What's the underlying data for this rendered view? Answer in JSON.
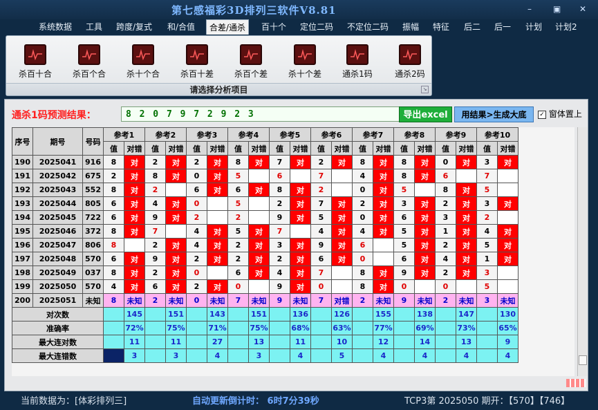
{
  "window": {
    "title": "第七感福彩3D排列三软件V8.81",
    "minimize": "–",
    "restore": "▣",
    "close": "✕"
  },
  "menu": [
    "系统数据",
    "工具",
    "跨度/复式",
    "和/合值",
    "合差/通杀",
    "百十个",
    "定位二码",
    "不定位二码",
    "振幅",
    "特征",
    "后二",
    "后一",
    "计划",
    "计划2"
  ],
  "ribbon": {
    "buttons": [
      "杀百十合",
      "杀百个合",
      "杀十个合",
      "杀百十差",
      "杀百个差",
      "杀十个差",
      "通杀1码",
      "通杀2码"
    ],
    "caption": "请选择分析项目"
  },
  "prediction": {
    "label": "通杀1码预测结果：",
    "value": "8 2 0 7 9 7 2 9 2 3"
  },
  "buttons": {
    "excel": "导出excel",
    "generate": "用结果>生成大底"
  },
  "checkbox": {
    "label": "窗体置上",
    "checked": "✓"
  },
  "grid": {
    "headers": {
      "seq": "序号",
      "period": "期号",
      "number": "号码",
      "val": "值",
      "judge": "对错"
    },
    "refs": [
      "参考1",
      "参考2",
      "参考3",
      "参考4",
      "参考5",
      "参考6",
      "参考7",
      "参考8",
      "参考9",
      "参考10"
    ],
    "rows": [
      {
        "seq": "190",
        "period": "2025041",
        "number": "916",
        "cells": [
          [
            "8",
            "对",
            1
          ],
          [
            "2",
            "对",
            1
          ],
          [
            "2",
            "对",
            1
          ],
          [
            "8",
            "对",
            1
          ],
          [
            "7",
            "对",
            1
          ],
          [
            "2",
            "对",
            1
          ],
          [
            "8",
            "对",
            1
          ],
          [
            "8",
            "对",
            1
          ],
          [
            "0",
            "对",
            1
          ],
          [
            "3",
            "对",
            1
          ]
        ]
      },
      {
        "seq": "191",
        "period": "2025042",
        "number": "675",
        "cells": [
          [
            "2",
            "对",
            1
          ],
          [
            "8",
            "对",
            1
          ],
          [
            "0",
            "对",
            1
          ],
          [
            "5",
            "",
            0
          ],
          [
            "6",
            "",
            0
          ],
          [
            "7",
            "",
            0
          ],
          [
            "4",
            "对",
            1
          ],
          [
            "8",
            "对",
            1
          ],
          [
            "6",
            "",
            0
          ],
          [
            "7",
            "",
            0
          ]
        ]
      },
      {
        "seq": "192",
        "period": "2025043",
        "number": "552",
        "cells": [
          [
            "8",
            "对",
            1
          ],
          [
            "2",
            "",
            0
          ],
          [
            "6",
            "对",
            1
          ],
          [
            "6",
            "对",
            1
          ],
          [
            "8",
            "对",
            1
          ],
          [
            "2",
            "",
            0
          ],
          [
            "0",
            "对",
            1
          ],
          [
            "5",
            "",
            0
          ],
          [
            "8",
            "对",
            1
          ],
          [
            "5",
            "",
            0
          ]
        ]
      },
      {
        "seq": "193",
        "period": "2025044",
        "number": "805",
        "cells": [
          [
            "6",
            "对",
            1
          ],
          [
            "4",
            "对",
            1
          ],
          [
            "0",
            "",
            0
          ],
          [
            "5",
            "",
            0
          ],
          [
            "2",
            "对",
            1
          ],
          [
            "7",
            "对",
            1
          ],
          [
            "2",
            "对",
            1
          ],
          [
            "3",
            "对",
            1
          ],
          [
            "2",
            "对",
            1
          ],
          [
            "3",
            "对",
            1
          ]
        ]
      },
      {
        "seq": "194",
        "period": "2025045",
        "number": "722",
        "cells": [
          [
            "6",
            "对",
            1
          ],
          [
            "9",
            "对",
            1
          ],
          [
            "2",
            "",
            0
          ],
          [
            "2",
            "",
            0
          ],
          [
            "9",
            "对",
            1
          ],
          [
            "5",
            "对",
            1
          ],
          [
            "0",
            "对",
            1
          ],
          [
            "6",
            "对",
            1
          ],
          [
            "3",
            "对",
            1
          ],
          [
            "2",
            "",
            0
          ]
        ]
      },
      {
        "seq": "195",
        "period": "2025046",
        "number": "372",
        "cells": [
          [
            "8",
            "对",
            1
          ],
          [
            "7",
            "",
            0
          ],
          [
            "4",
            "对",
            1
          ],
          [
            "5",
            "对",
            1
          ],
          [
            "7",
            "",
            0
          ],
          [
            "4",
            "对",
            1
          ],
          [
            "4",
            "对",
            1
          ],
          [
            "5",
            "对",
            1
          ],
          [
            "1",
            "对",
            1
          ],
          [
            "4",
            "对",
            1
          ]
        ]
      },
      {
        "seq": "196",
        "period": "2025047",
        "number": "806",
        "cells": [
          [
            "8",
            "",
            0
          ],
          [
            "2",
            "对",
            1
          ],
          [
            "4",
            "对",
            1
          ],
          [
            "2",
            "对",
            1
          ],
          [
            "3",
            "对",
            1
          ],
          [
            "9",
            "对",
            1
          ],
          [
            "6",
            "",
            0
          ],
          [
            "5",
            "对",
            1
          ],
          [
            "2",
            "对",
            1
          ],
          [
            "5",
            "对",
            1
          ]
        ]
      },
      {
        "seq": "197",
        "period": "2025048",
        "number": "570",
        "cells": [
          [
            "6",
            "对",
            1
          ],
          [
            "9",
            "对",
            1
          ],
          [
            "2",
            "对",
            1
          ],
          [
            "2",
            "对",
            1
          ],
          [
            "2",
            "对",
            1
          ],
          [
            "6",
            "对",
            1
          ],
          [
            "0",
            "",
            0
          ],
          [
            "6",
            "对",
            1
          ],
          [
            "4",
            "对",
            1
          ],
          [
            "1",
            "对",
            1
          ]
        ]
      },
      {
        "seq": "198",
        "period": "2025049",
        "number": "037",
        "cells": [
          [
            "8",
            "对",
            1
          ],
          [
            "2",
            "对",
            1
          ],
          [
            "0",
            "",
            0
          ],
          [
            "6",
            "对",
            1
          ],
          [
            "4",
            "对",
            1
          ],
          [
            "7",
            "",
            0
          ],
          [
            "8",
            "对",
            1
          ],
          [
            "9",
            "对",
            1
          ],
          [
            "2",
            "对",
            1
          ],
          [
            "3",
            "",
            0
          ]
        ]
      },
      {
        "seq": "199",
        "period": "2025050",
        "number": "570",
        "cells": [
          [
            "4",
            "对",
            1
          ],
          [
            "6",
            "对",
            1
          ],
          [
            "2",
            "对",
            1
          ],
          [
            "0",
            "",
            0
          ],
          [
            "9",
            "对",
            1
          ],
          [
            "0",
            "",
            0
          ],
          [
            "8",
            "对",
            1
          ],
          [
            "0",
            "",
            0
          ],
          [
            "0",
            "",
            0
          ],
          [
            "5",
            "",
            0
          ]
        ]
      },
      {
        "seq": "200",
        "period": "2025051",
        "number": "未知",
        "cells": [
          [
            "8",
            "未知",
            2
          ],
          [
            "2",
            "未知",
            2
          ],
          [
            "0",
            "未知",
            2
          ],
          [
            "7",
            "未知",
            2
          ],
          [
            "9",
            "未知",
            2
          ],
          [
            "7",
            "对错",
            2
          ],
          [
            "2",
            "未知",
            2
          ],
          [
            "9",
            "未知",
            2
          ],
          [
            "2",
            "未知",
            2
          ],
          [
            "3",
            "未知",
            2
          ]
        ]
      }
    ],
    "stats": [
      {
        "label": "对次数",
        "values": [
          "145",
          "151",
          "143",
          "151",
          "136",
          "126",
          "155",
          "138",
          "147",
          "130"
        ]
      },
      {
        "label": "准确率",
        "values": [
          "72%",
          "75%",
          "71%",
          "75%",
          "68%",
          "63%",
          "77%",
          "69%",
          "73%",
          "65%"
        ]
      },
      {
        "label": "最大连对数",
        "values": [
          "11",
          "11",
          "27",
          "13",
          "11",
          "10",
          "12",
          "14",
          "13",
          "9"
        ]
      },
      {
        "label": "最大连错数",
        "values": [
          "3",
          "3",
          "4",
          "3",
          "4",
          "5",
          "4",
          "4",
          "4",
          "4"
        ]
      }
    ]
  },
  "status": {
    "data_source": "当前数据为：[体彩排列三]",
    "countdown": "自动更新倒计时：  6时7分39秒",
    "draw_info": "TCP3第 2025050 期开：【570】【746】"
  }
}
